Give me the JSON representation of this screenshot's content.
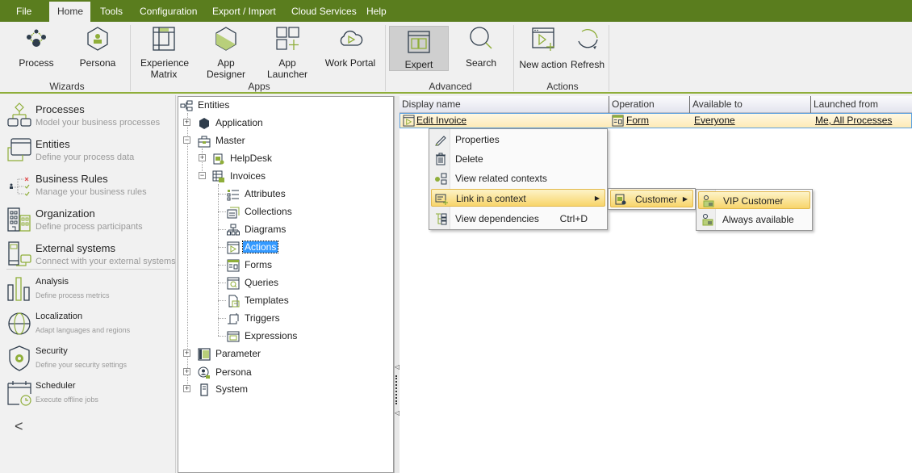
{
  "menubar": {
    "tabs": [
      {
        "label": "File",
        "active": false
      },
      {
        "label": "Home",
        "active": true
      },
      {
        "label": "Tools",
        "active": false
      },
      {
        "label": "Configuration",
        "active": false
      },
      {
        "label": "Export / Import",
        "active": false
      },
      {
        "label": "Cloud Services",
        "active": false
      },
      {
        "label": "Help",
        "active": false
      }
    ]
  },
  "ribbon": {
    "groups": {
      "wizards": "Wizards",
      "apps": "Apps",
      "advanced": "Advanced",
      "actions": "Actions"
    },
    "buttons": {
      "process": "Process",
      "persona": "Persona",
      "experience_matrix": "Experience Matrix",
      "app_designer": "App Designer",
      "app_launcher": "App Launcher",
      "work_portal": "Work Portal",
      "expert": "Expert",
      "search": "Search",
      "new_action": "New action",
      "refresh": "Refresh"
    }
  },
  "leftnav": {
    "items": [
      {
        "title": "Processes",
        "subtitle": "Model your business processes"
      },
      {
        "title": "Entities",
        "subtitle": "Define your process data"
      },
      {
        "title": "Business Rules",
        "subtitle": "Manage your business rules"
      },
      {
        "title": "Organization",
        "subtitle": "Define process participants"
      },
      {
        "title": "External systems",
        "subtitle": "Connect with your external systems"
      },
      {
        "title": "Analysis",
        "subtitle": "Define process metrics"
      },
      {
        "title": "Localization",
        "subtitle": "Adapt languages and regions"
      },
      {
        "title": "Security",
        "subtitle": "Define your security settings"
      },
      {
        "title": "Scheduler",
        "subtitle": "Execute offline jobs"
      }
    ],
    "collapse_glyph": "<"
  },
  "tree": {
    "root": "Entities",
    "application": "Application",
    "master": "Master",
    "helpdesk": "HelpDesk",
    "invoices": "Invoices",
    "invoice_children": [
      "Attributes",
      "Collections",
      "Diagrams",
      "Actions",
      "Forms",
      "Queries",
      "Templates",
      "Triggers",
      "Expressions"
    ],
    "selected": "Actions",
    "parameter": "Parameter",
    "persona": "Persona",
    "system": "System"
  },
  "grid": {
    "columns": [
      "Display name",
      "Operation",
      "Available to",
      "Launched from"
    ],
    "rows": [
      {
        "display_name": "Edit Invoice",
        "operation": "Form",
        "available_to": "Everyone",
        "launched_from": "Me, All Processes"
      }
    ]
  },
  "context_menu": {
    "items": [
      {
        "label": "Properties",
        "icon": "pencil-icon"
      },
      {
        "label": "Delete",
        "icon": "trash-icon"
      },
      {
        "label": "View related contexts",
        "icon": "related-contexts-icon"
      },
      {
        "label": "Link in a context",
        "icon": "link-context-icon",
        "has_submenu": true
      },
      {
        "label": "View dependencies",
        "icon": "dependencies-icon",
        "shortcut": "Ctrl+D"
      }
    ],
    "submenu": {
      "items": [
        {
          "label": "Customer",
          "has_submenu": true
        }
      ]
    },
    "submenu2": {
      "items": [
        {
          "label": "VIP Customer"
        },
        {
          "label": "Always available"
        }
      ]
    }
  },
  "colors": {
    "brand_green": "#5a7d1e",
    "accent_green": "#8fae3a",
    "selection_blue": "#3399ff",
    "highlight_gold": "#f8d56b"
  }
}
